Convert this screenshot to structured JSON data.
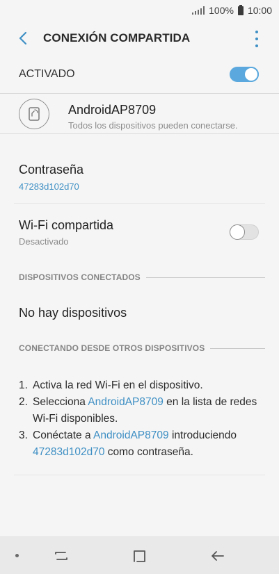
{
  "status_bar": {
    "battery": "100%",
    "time": "10:00"
  },
  "header": {
    "title": "CONEXIÓN COMPARTIDA"
  },
  "master_switch": {
    "label": "ACTIVADO",
    "state": "on"
  },
  "hotspot": {
    "name": "AndroidAP8709",
    "visibility": "Todos los dispositivos pueden conectarse."
  },
  "password": {
    "title": "Contraseña",
    "value": "47283d102d70"
  },
  "wifi_sharing": {
    "title": "Wi-Fi compartida",
    "status": "Desactivado",
    "state": "off"
  },
  "connected_devices": {
    "header": "DISPOSITIVOS CONECTADOS",
    "empty_text": "No hay dispositivos"
  },
  "connecting": {
    "header": "CONECTANDO DESDE OTROS DISPOSITIVOS",
    "step1": {
      "num": "1.",
      "text": "Activa la red Wi-Fi en el dispositivo."
    },
    "step2": {
      "num": "2.",
      "pre": "Selecciona ",
      "link": "AndroidAP8709",
      "post": " en la lista de redes Wi-Fi disponibles."
    },
    "step3": {
      "num": "3.",
      "pre": "Conéctate a ",
      "link": "AndroidAP8709",
      "mid": " introduciendo ",
      "link2": "47283d102d70",
      "post": " como contraseña."
    }
  },
  "colors": {
    "accent": "#3e8fc4",
    "toggle_on": "#5aa8dd",
    "background": "#f5f5f5"
  },
  "icons": {
    "back": "chevron-left-icon",
    "more": "more-vertical-icon",
    "hotspot": "device-share-icon",
    "nav_recent": "recent-apps-icon",
    "nav_home": "home-icon",
    "nav_back": "back-arrow-icon"
  }
}
